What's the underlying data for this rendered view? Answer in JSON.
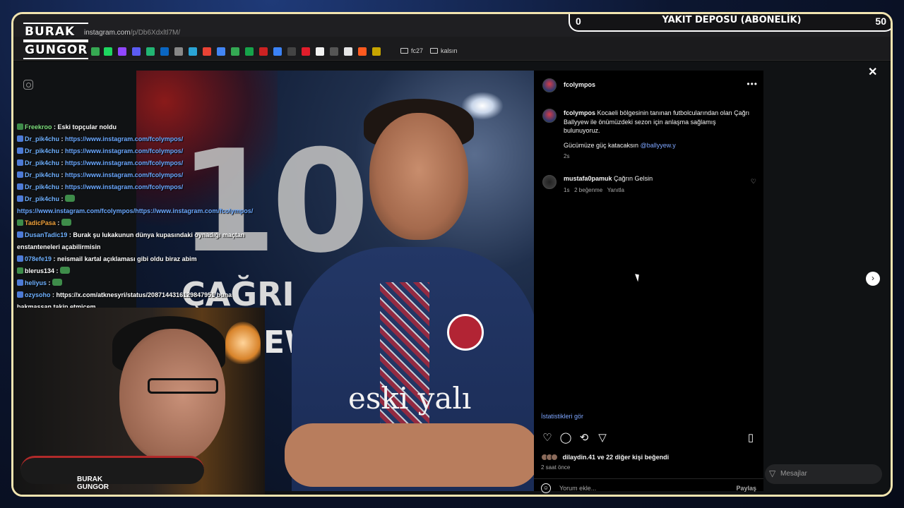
{
  "browser": {
    "url_host": "instagram.com",
    "url_path": "/p/Db6Xdxltl7M/",
    "bookmarks": [
      "fc27",
      "kalsın"
    ]
  },
  "branding": {
    "logo_line1": "BURAK",
    "logo_line2": "GUNGOR",
    "cam_logo": "BURAK GUNGOR"
  },
  "overlay": {
    "left_value": "0",
    "title": "YAKIT DEPOSU (ABONELİK)",
    "right_value": "50"
  },
  "photo": {
    "number": "10",
    "name_top": "ÇAĞRI",
    "name_bottom": "EW",
    "jersey_text": "eski yalı"
  },
  "chat": [
    {
      "user": "Freekroo",
      "text": "Eski topçular noldu",
      "user_color": "green"
    },
    {
      "user": "Dr_pik4chu",
      "text": "https://www.instagram.com/fcolympos/",
      "user_color": "blue",
      "link": true
    },
    {
      "user": "Dr_pik4chu",
      "text": "https://www.instagram.com/fcolympos/",
      "user_color": "blue",
      "link": true
    },
    {
      "user": "Dr_pik4chu",
      "text": "https://www.instagram.com/fcolympos/",
      "user_color": "blue",
      "link": true
    },
    {
      "user": "Dr_pik4chu",
      "text": "https://www.instagram.com/fcolympos/",
      "user_color": "blue",
      "link": true
    },
    {
      "user": "Dr_pik4chu",
      "text": "https://www.instagram.com/fcolympos/",
      "user_color": "blue",
      "link": true
    },
    {
      "user": "Dr_pik4chu",
      "text": "",
      "user_color": "blue"
    },
    {
      "user": "",
      "text": "https://www.instagram.com/fcolympos/https://www.instagram.com/fcolympos/",
      "user_color": "blue",
      "link": true
    },
    {
      "user": "TadicPasa",
      "text": "",
      "user_color": "orange"
    },
    {
      "user": "DusanTadic19",
      "text": "Burak şu lukakunun dünya kupasındaki oynadığı maçtan enstanteneleri açabilirmisin",
      "user_color": "blue"
    },
    {
      "user": "078efe19",
      "text": "neismail kartal açıklaması gibi oldu biraz abim",
      "user_color": "blue"
    },
    {
      "user": "blerus134",
      "text": "",
      "user_color": "white"
    },
    {
      "user": "heliyus",
      "text": "",
      "user_color": "blue"
    },
    {
      "user": "ozysoho",
      "text": "https://x.com/atknesyri/status/2087144316129847951 buna bakmassan takip etmicem",
      "user_color": "blue"
    }
  ],
  "post": {
    "username": "fcolympos",
    "more_label": "•••",
    "caption_user": "fcolympos",
    "caption_line1": "Kocaeli bölgesinin tanınan futbolcularından olan Çağrı Ballyyew ile önümüzdeki sezon için anlaşma sağlamış bulunuyoruz.",
    "caption_line2_pre": "Gücümüze güç katacaksın",
    "caption_tag": "@ballyyew.y",
    "caption_time": "2s",
    "comment_user": "mustafa0pamuk",
    "comment_text": "Çağrın Gelsin",
    "comment_time": "1s",
    "comment_likes": "2 beğenme",
    "comment_reply": "Yanıtla",
    "insights_label": "İstatistikleri gör",
    "likes_user": "dilaydin.41",
    "likes_text": "ve 22 diğer kişi beğendi",
    "post_time": "2 saat önce",
    "comment_placeholder": "Yorum ekle...",
    "post_button": "Paylaş"
  },
  "messages_label": "Mesajlar",
  "colors": {
    "accent_link": "#7ea6ff",
    "frame": "#f1e4b0",
    "panel_bg": "#000000"
  }
}
